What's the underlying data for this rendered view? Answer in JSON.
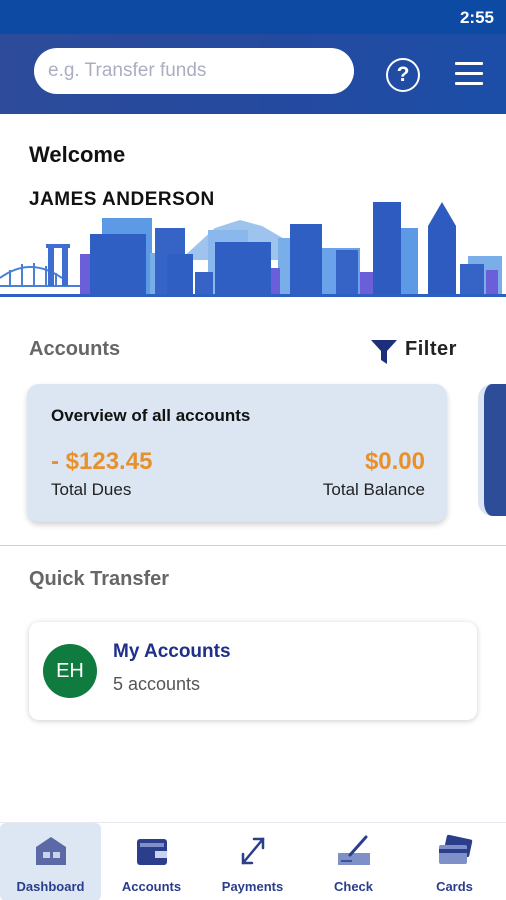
{
  "status_bar": {
    "time": "2:55"
  },
  "header": {
    "search_placeholder": "e.g. Transfer funds",
    "help_icon": "question-circle-icon",
    "menu_icon": "hamburger-menu-icon"
  },
  "welcome": {
    "title": "Welcome",
    "user_name": "JAMES ANDERSON"
  },
  "accounts": {
    "title": "Accounts",
    "filter_label": "Filter",
    "overview": {
      "title": "Overview of all accounts",
      "dues_amount": "- $123.45",
      "dues_label": "Total Dues",
      "balance_amount": "$0.00",
      "balance_label": "Total Balance"
    }
  },
  "quick_transfer": {
    "title": "Quick Transfer",
    "item": {
      "initials": "EH",
      "name": "My Accounts",
      "count": "5 accounts"
    }
  },
  "bottom_nav": {
    "items": [
      {
        "label": "Dashboard",
        "icon": "dashboard-icon",
        "active": true
      },
      {
        "label": "Accounts",
        "icon": "wallet-icon",
        "active": false
      },
      {
        "label": "Payments",
        "icon": "transfer-arrows-icon",
        "active": false
      },
      {
        "label": "Check",
        "icon": "check-deposit-icon",
        "active": false
      },
      {
        "label": "Cards",
        "icon": "cards-icon",
        "active": false
      }
    ]
  },
  "colors": {
    "header_blue": "#244a9f",
    "status_blue": "#0d4aa3",
    "amount_orange": "#e8902c",
    "card_background": "#dbe6f2",
    "avatar_green": "#0f7b3f",
    "nav_text": "#2a3e8c"
  }
}
